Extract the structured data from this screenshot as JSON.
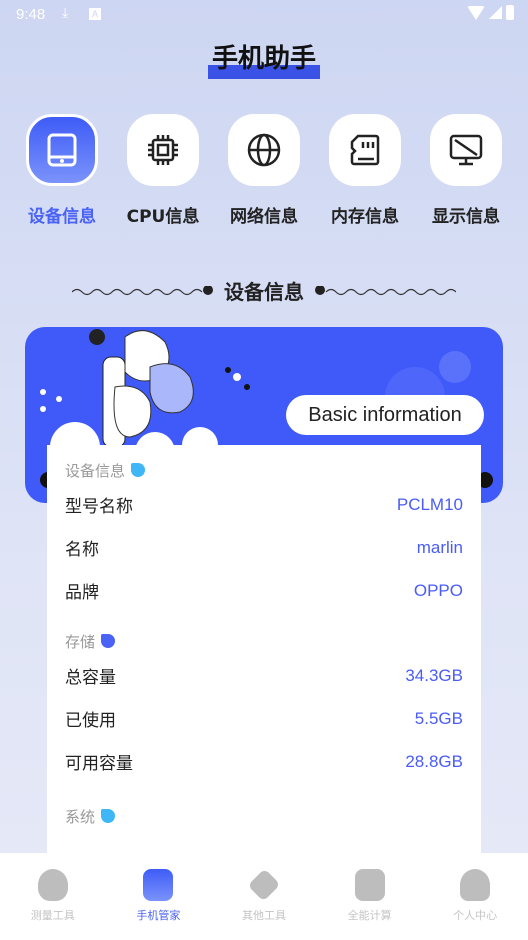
{
  "status": {
    "time": "9:48"
  },
  "app_title": "手机助手",
  "categories": [
    {
      "label": "设备信息",
      "icon": "tablet-icon",
      "active": true
    },
    {
      "label": "CPU信息",
      "icon": "cpu-chip-icon"
    },
    {
      "label": "网络信息",
      "icon": "globe-icon"
    },
    {
      "label": "内存信息",
      "icon": "sd-card-icon"
    },
    {
      "label": "显示信息",
      "icon": "monitor-icon"
    }
  ],
  "section_title": "设备信息",
  "banner": {
    "label": "Basic information"
  },
  "groups": [
    {
      "title": "设备信息",
      "dot_color": "#3fb6f5",
      "rows": [
        {
          "label": "型号名称",
          "value": "PCLM10"
        },
        {
          "label": "名称",
          "value": "marlin"
        },
        {
          "label": "品牌",
          "value": "OPPO"
        }
      ]
    },
    {
      "title": "存储",
      "dot_color": "#4a63f5",
      "rows": [
        {
          "label": "总容量",
          "value": "34.3GB"
        },
        {
          "label": "已使用",
          "value": "5.5GB"
        },
        {
          "label": "可用容量",
          "value": "28.8GB"
        }
      ]
    },
    {
      "title": "系统",
      "dot_color": "#3fb6f5",
      "rows": []
    }
  ],
  "nav": [
    {
      "label": "测量工具",
      "icon": "measure-robot-icon"
    },
    {
      "label": "手机管家",
      "icon": "phone-manager-icon",
      "active": true
    },
    {
      "label": "其他工具",
      "icon": "layers-icon"
    },
    {
      "label": "全能计算",
      "icon": "calculator-icon"
    },
    {
      "label": "个人中心",
      "icon": "user-icon"
    }
  ],
  "colors": {
    "accent": "#3f5af9",
    "value": "#4a5cf5"
  }
}
